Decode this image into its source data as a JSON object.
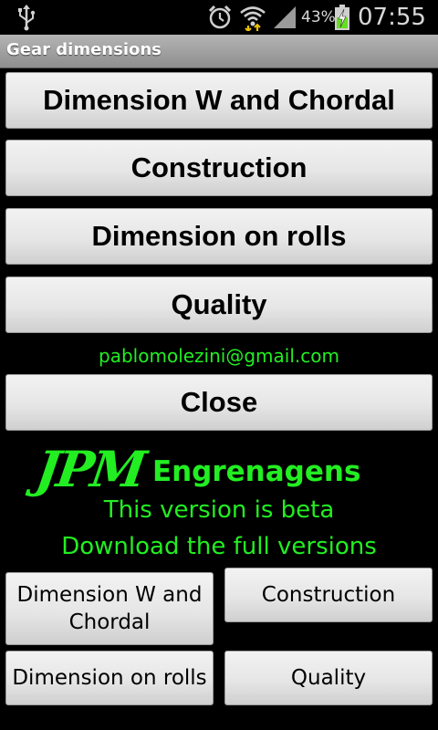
{
  "status_bar": {
    "battery_percent": "43%",
    "time": "07:55",
    "icons": [
      "usb-icon",
      "alarm-icon",
      "wifi-icon",
      "signal-icon",
      "battery-charging-icon"
    ]
  },
  "app": {
    "title": "Gear dimensions"
  },
  "main_buttons": {
    "dimension_w": "Dimension W and Chordal",
    "construction": "Construction",
    "dimension_rolls": "Dimension on rolls",
    "quality": "Quality"
  },
  "email": "pablomolezini@gmail.com",
  "close_label": "Close",
  "promo": {
    "logo": "JPM",
    "brand": "Engrenagens",
    "beta_text": "This version is beta",
    "download_text": "Download the full versions"
  },
  "full_buttons": {
    "dimension_w": "Dimension W and Chordal",
    "construction": "Construction",
    "dimension_rolls": "Dimension on rolls",
    "quality": "Quality"
  },
  "colors": {
    "accent_green": "#22ee22",
    "background": "#000000"
  }
}
